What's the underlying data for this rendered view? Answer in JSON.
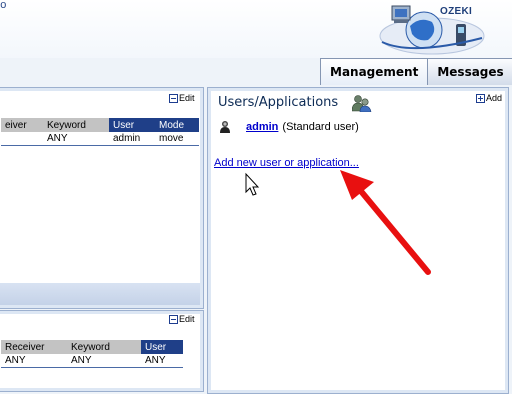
{
  "header": {
    "fragment": "o",
    "logo_text": "OZEKI"
  },
  "tabs": [
    {
      "label": "Management",
      "active": true
    },
    {
      "label": "Messages",
      "active": false
    }
  ],
  "left_top": {
    "edit_label": "Edit",
    "columns": [
      "eiver",
      "Keyword",
      "User",
      "Mode"
    ],
    "rows": [
      [
        "",
        "ANY",
        "admin",
        "move"
      ]
    ]
  },
  "left_bottom": {
    "edit_label": "Edit",
    "columns": [
      "Receiver",
      "Keyword",
      "User"
    ],
    "rows": [
      [
        "ANY",
        "ANY",
        "ANY"
      ]
    ]
  },
  "users": {
    "title": "Users/Applications",
    "add_label": "Add",
    "user_name": "admin",
    "user_role": "(Standard user)",
    "add_new_link": "Add new user or application..."
  },
  "colors": {
    "accent": "#1f3f88",
    "link": "#0000cc",
    "arrow": "#e81010"
  },
  "icons": [
    "logo-icon",
    "edit-icon",
    "users-icon",
    "add-icon",
    "user-icon",
    "mouse-cursor-icon",
    "red-arrow-icon"
  ]
}
